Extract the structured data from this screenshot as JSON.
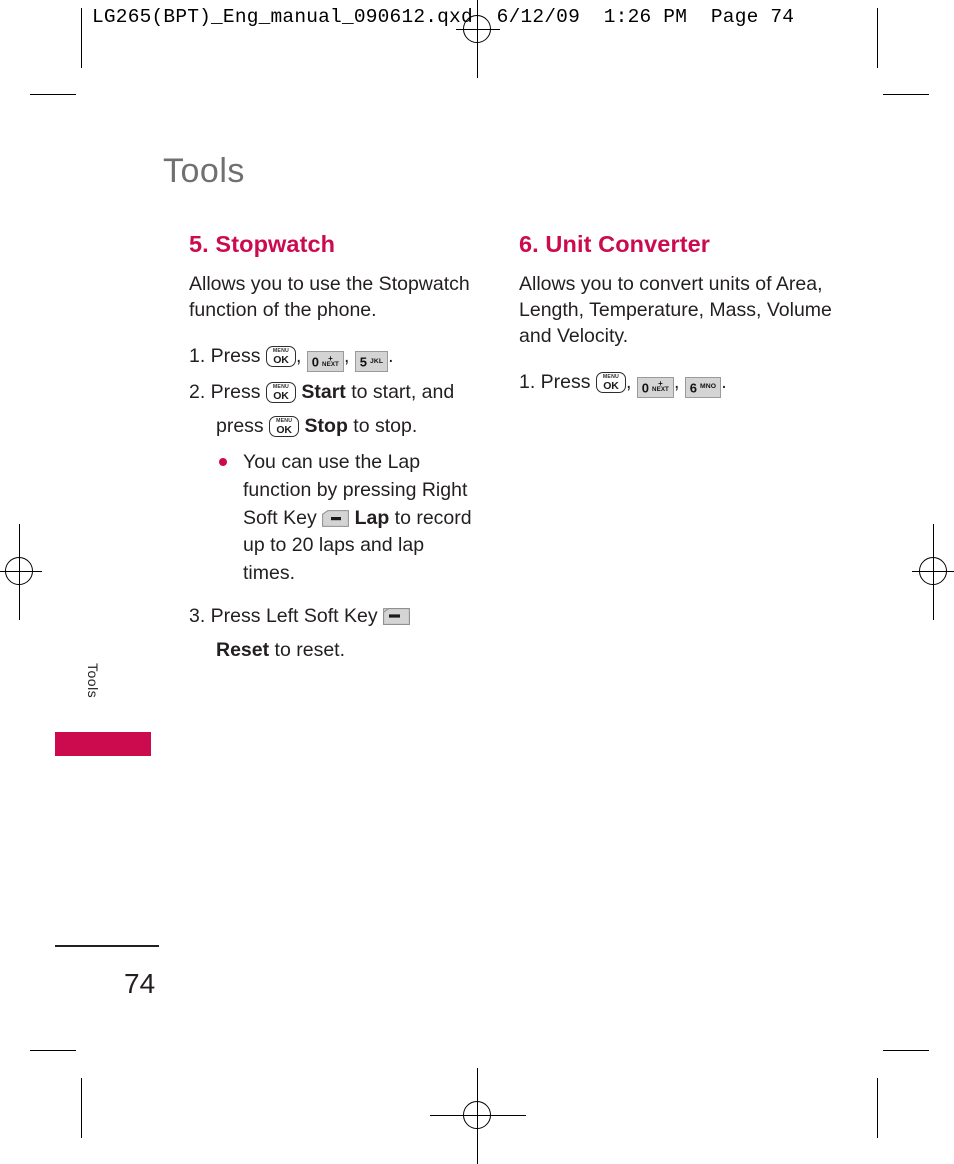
{
  "prepress": {
    "header_line": "LG265(BPT)_Eng_manual_090612.qxd  6/12/09  1:26 PM  Page 74"
  },
  "page": {
    "title": "Tools",
    "side_tab_label": "Tools",
    "page_number": "74",
    "accent_color": "#cc0b4f",
    "title_color": "#6f7072",
    "body_color": "#231f20"
  },
  "keys": {
    "menu_ok": {
      "top": "MENU",
      "bottom": "OK"
    },
    "zero": {
      "digit": "0",
      "plus": "+",
      "label": "NEXT"
    },
    "five": {
      "digit": "5",
      "label": "JKL"
    },
    "six": {
      "digit": "6",
      "label": "MNO"
    },
    "left_soft": "left-soft-key",
    "right_soft": "right-soft-key"
  },
  "left_column": {
    "heading": "5. Stopwatch",
    "intro": "Allows you to use the Stopwatch function of the phone.",
    "step1": {
      "num": "1. Press",
      "sep1": ",",
      "sep2": ",",
      "end": "."
    },
    "step2": {
      "num": "2. Press",
      "start_label": "Start",
      "start_tail": "to start, and",
      "press": "press",
      "stop_label": "Stop",
      "stop_tail": "to stop."
    },
    "bullet": {
      "part1": "You can use the Lap function by pressing Right Soft Key",
      "lap_label": "Lap",
      "part2": "to record up to 20 laps and lap times."
    },
    "step3": {
      "num": "3. Press Left Soft Key",
      "reset_label": "Reset",
      "tail": "to reset."
    }
  },
  "right_column": {
    "heading": "6. Unit Converter",
    "intro": "Allows you to convert units of Area, Length, Temperature, Mass, Volume and Velocity.",
    "step1": {
      "num": "1. Press",
      "sep1": ",",
      "sep2": ",",
      "end": "."
    }
  }
}
